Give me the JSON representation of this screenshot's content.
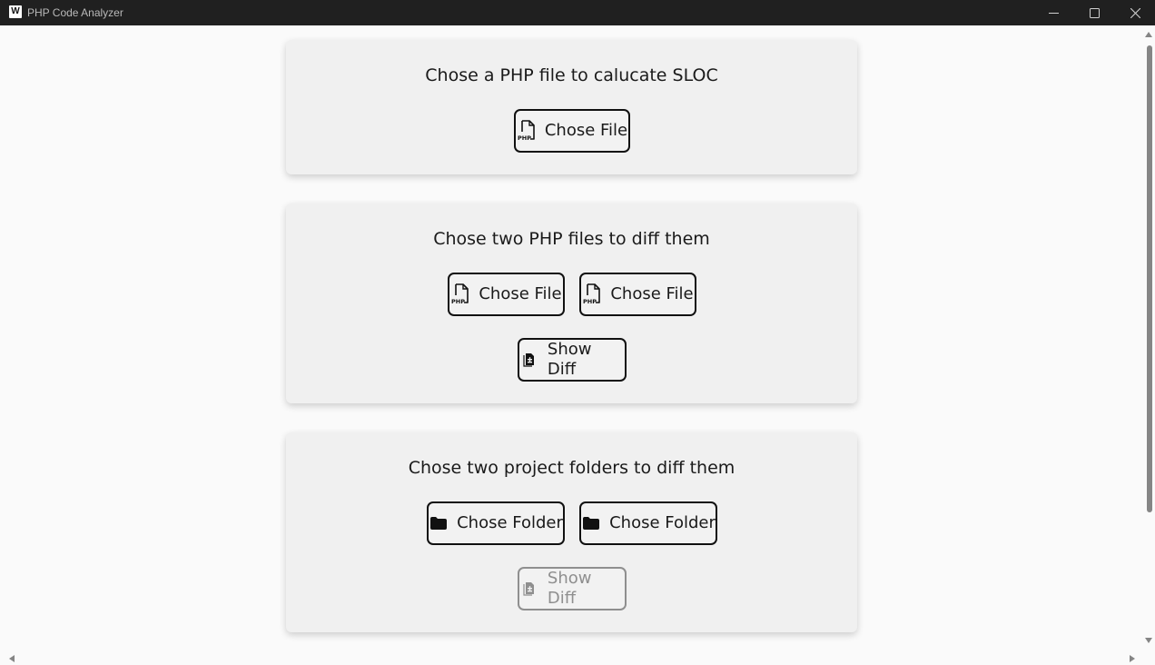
{
  "window": {
    "title": "PHP Code Analyzer",
    "icon_letter": "W"
  },
  "cards": [
    {
      "heading": "Chose a PHP file to calucate SLOC",
      "buttons": [
        {
          "label": "Chose File",
          "icon": "php-file-icon"
        }
      ]
    },
    {
      "heading": "Chose two PHP files to diff them",
      "buttons": [
        {
          "label": "Chose File",
          "icon": "php-file-icon"
        },
        {
          "label": "Chose File",
          "icon": "php-file-icon"
        },
        {
          "label": "Show Diff",
          "icon": "file-diff-icon",
          "enabled": true
        }
      ]
    },
    {
      "heading": "Chose two project folders to diff them",
      "buttons": [
        {
          "label": "Chose Folder",
          "icon": "folder-icon"
        },
        {
          "label": "Chose Folder",
          "icon": "folder-icon"
        },
        {
          "label": "Show Diff",
          "icon": "file-diff-icon",
          "enabled": false
        }
      ]
    }
  ],
  "colors": {
    "titlebar": "#202020",
    "card_bg": "#f0f0f0",
    "border": "#111111",
    "disabled": "#8f8f8f"
  }
}
